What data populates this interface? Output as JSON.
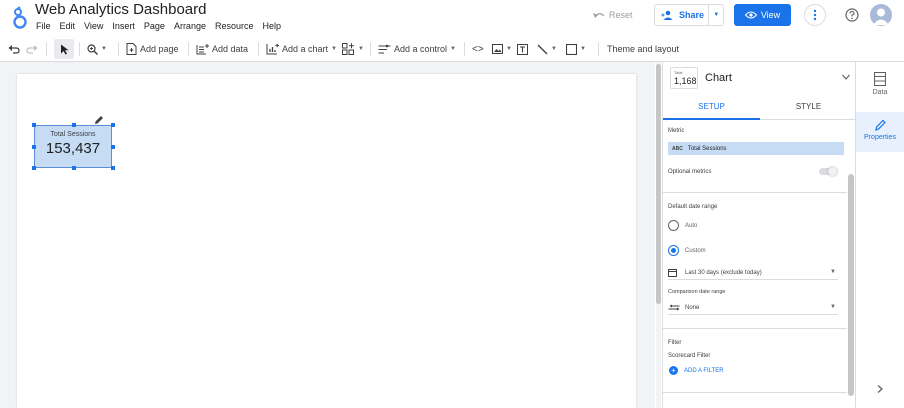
{
  "header": {
    "title": "Web Analytics Dashboard",
    "menu": [
      "File",
      "Edit",
      "View",
      "Insert",
      "Page",
      "Arrange",
      "Resource",
      "Help"
    ],
    "reset_label": "Reset",
    "share_label": "Share",
    "view_label": "View",
    "accent_color": "#1a73e8"
  },
  "toolbar": {
    "add_page": "Add page",
    "add_data": "Add data",
    "add_chart": "Add a chart",
    "add_control": "Add a control",
    "theme_layout": "Theme and layout"
  },
  "canvas": {
    "scorecard": {
      "label": "Total Sessions",
      "value": "153,437"
    }
  },
  "panel": {
    "thumb_small": "Total",
    "thumb_value": "1,168",
    "title": "Chart",
    "tabs": [
      "SETUP",
      "STYLE"
    ],
    "metric_label": "Metric",
    "metric_type": "ABC",
    "metric_value": "Total Sessions",
    "optional_metrics": "Optional metrics",
    "date_range_label": "Default date range",
    "auto_label": "Auto",
    "custom_label": "Custom",
    "date_range_value": "Last 30 days (exclude today)",
    "comparison_label": "Comparison date range",
    "comparison_value": "None",
    "filter_label": "Filter",
    "scorecard_filter": "Scorecard Filter",
    "add_filter": "ADD A FILTER"
  },
  "rail": {
    "data": "Data",
    "properties": "Properties"
  }
}
